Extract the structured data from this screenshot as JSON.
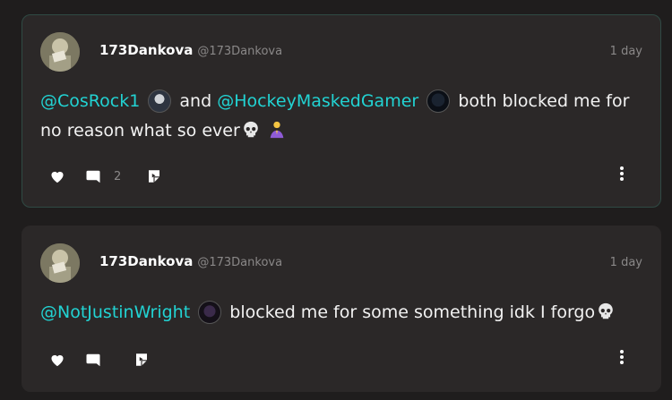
{
  "posts": [
    {
      "author": {
        "name": "173Dankova",
        "handle": "@173Dankova"
      },
      "time": "1 day",
      "body": {
        "mention1": "@CosRock1",
        "word_and": "and",
        "mention2": "@HockeyMaskedGamer",
        "text": "both blocked me for no reason what so ever"
      },
      "stats": {
        "comments": "2"
      }
    },
    {
      "author": {
        "name": "173Dankova",
        "handle": "@173Dankova"
      },
      "time": "1 day",
      "body": {
        "mention1": "@NotJustinWright",
        "text": "blocked me for some something idk I forgo"
      },
      "stats": {
        "comments": ""
      }
    }
  ],
  "icons": [
    "heart-icon",
    "comment-icon",
    "share-icon",
    "more-icon",
    "skull-emoji",
    "praying-emoji"
  ],
  "colors": {
    "mention": "#22d3d3",
    "card": "#2b2828",
    "background": "#1f1d1d",
    "card_highlight_border": "#2f4a44"
  }
}
